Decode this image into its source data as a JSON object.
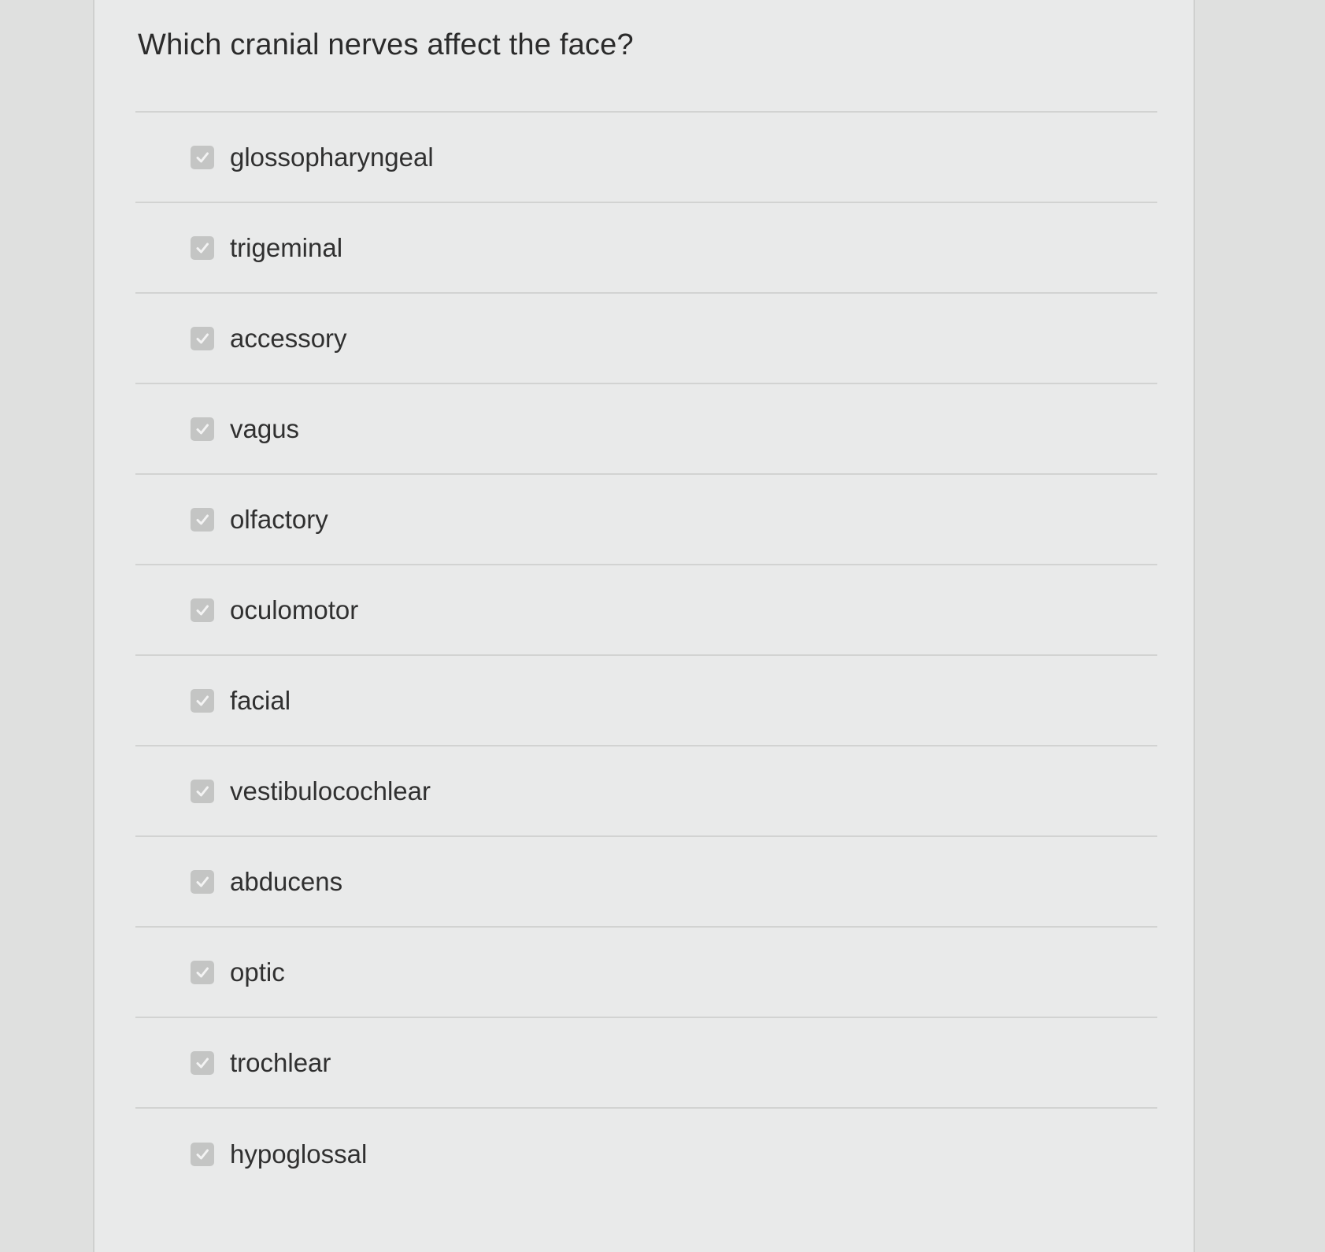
{
  "question": {
    "text": "Which cranial nerves affect the face?"
  },
  "options": [
    {
      "label": "glossopharyngeal",
      "checked": true
    },
    {
      "label": "trigeminal",
      "checked": true
    },
    {
      "label": "accessory",
      "checked": true
    },
    {
      "label": "vagus",
      "checked": true
    },
    {
      "label": "olfactory",
      "checked": true
    },
    {
      "label": "oculomotor",
      "checked": true
    },
    {
      "label": "facial",
      "checked": true
    },
    {
      "label": "vestibulocochlear",
      "checked": true
    },
    {
      "label": "abducens",
      "checked": true
    },
    {
      "label": "optic",
      "checked": true
    },
    {
      "label": "trochlear",
      "checked": true
    },
    {
      "label": "hypoglossal",
      "checked": true
    }
  ],
  "colors": {
    "checkbox_fill": "#c4c5c4",
    "checkmark": "#f3f3f3",
    "text": "#303030",
    "panel": "#e9eaea",
    "divider": "#d2d3d2"
  }
}
